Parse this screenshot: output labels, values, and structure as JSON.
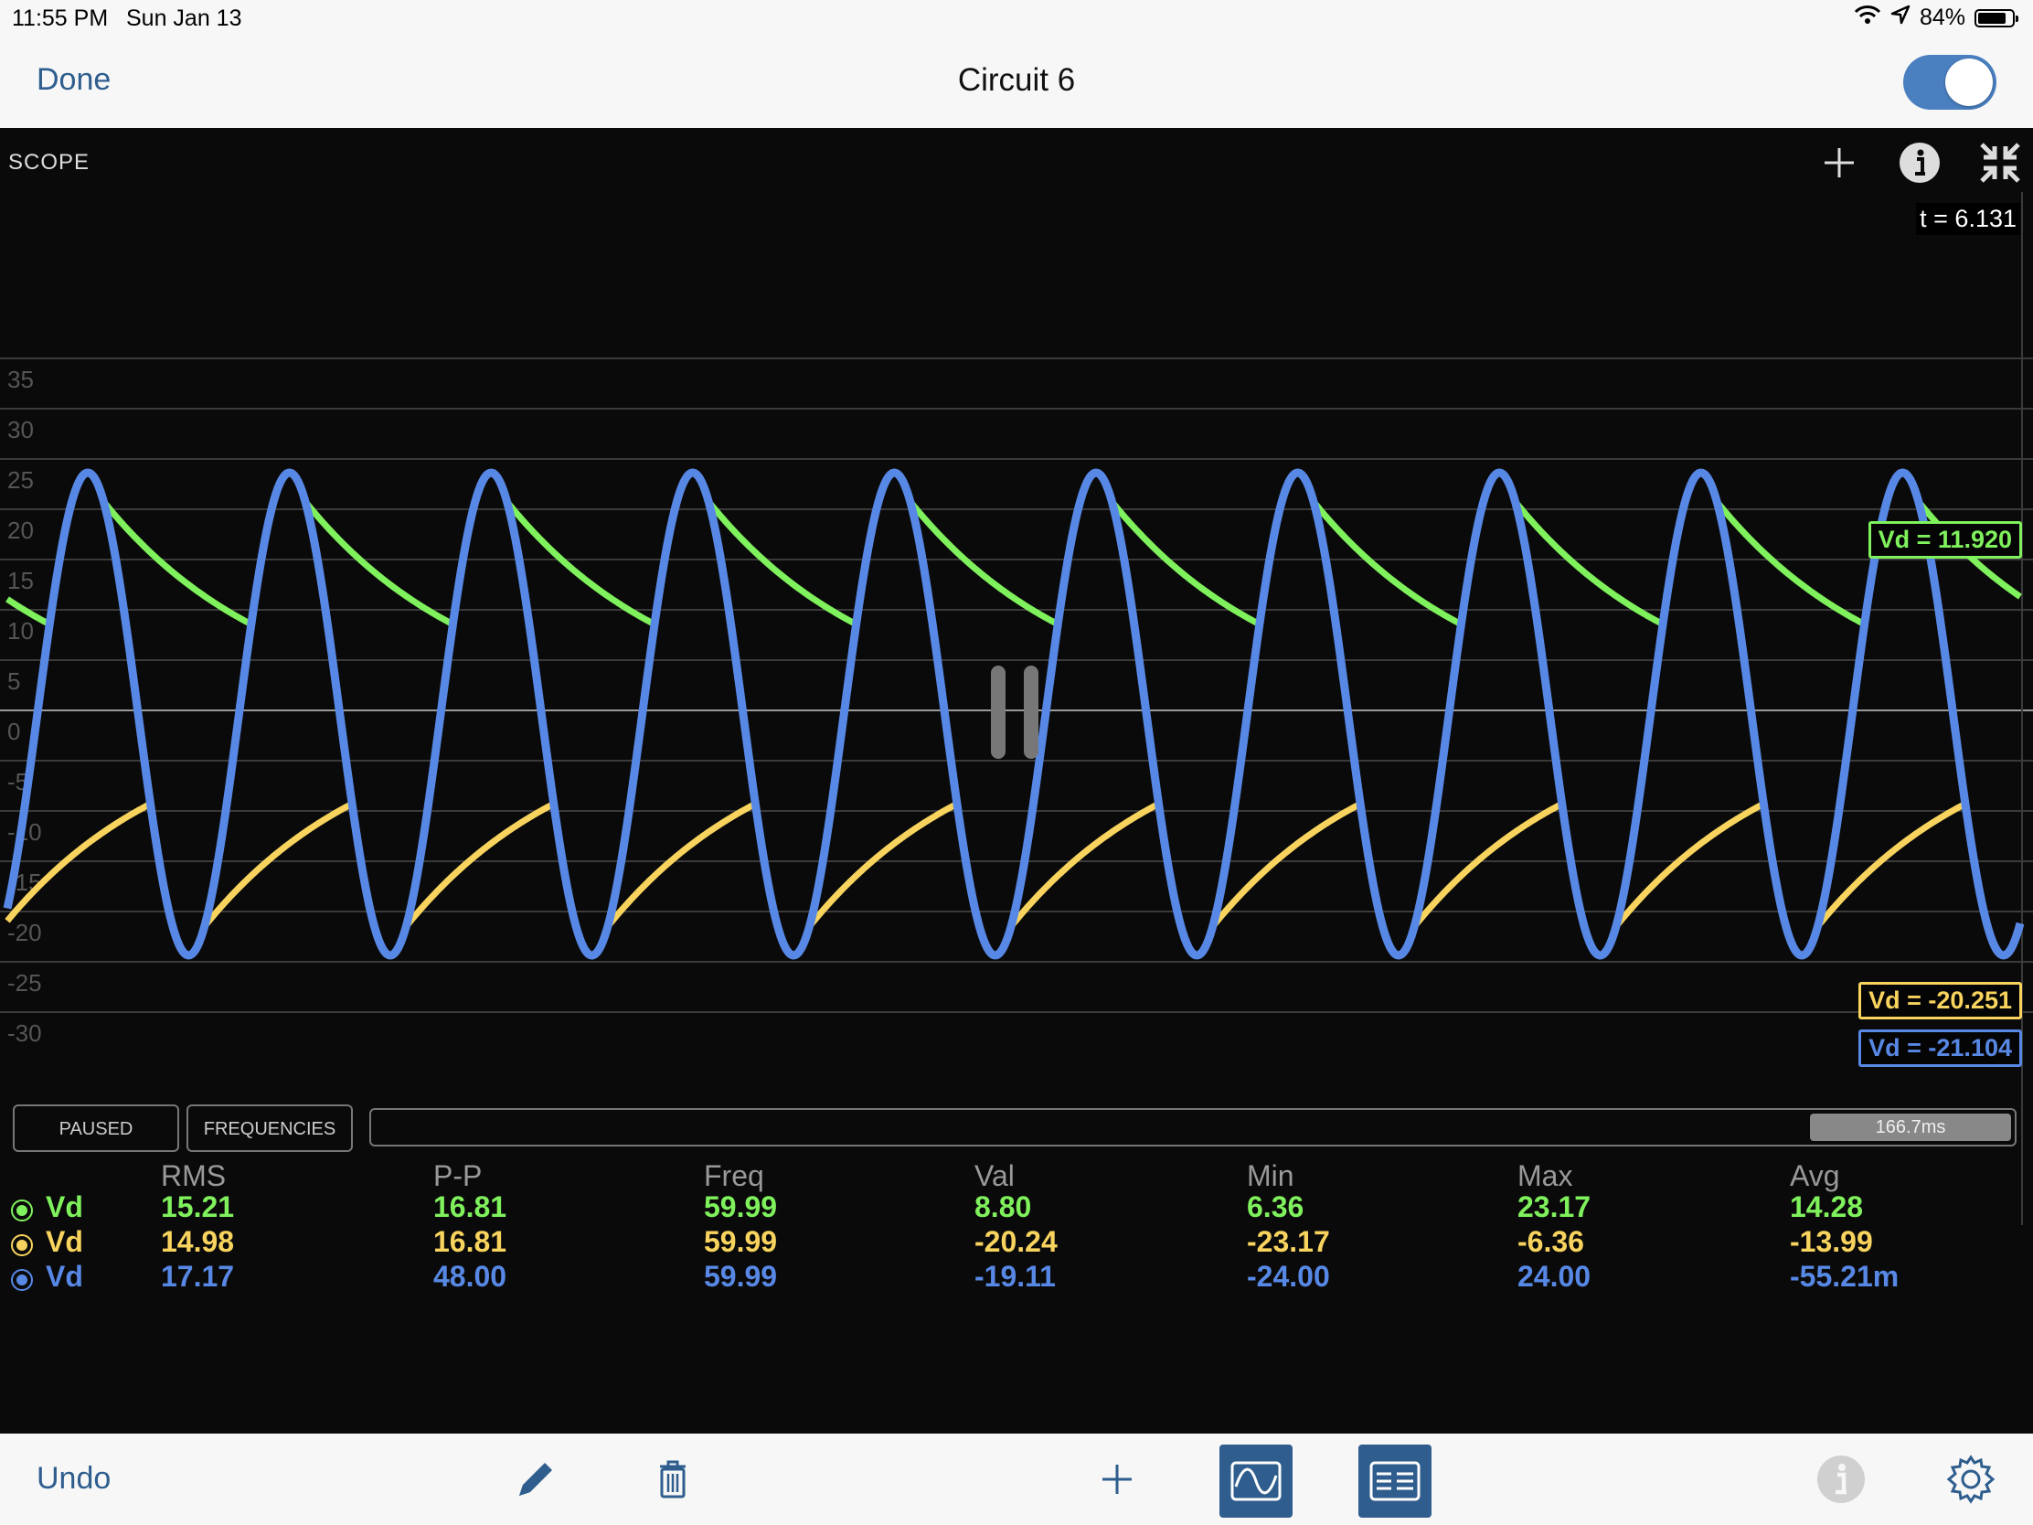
{
  "status_bar": {
    "time": "11:55 PM",
    "date": "Sun Jan 13",
    "battery": "84%",
    "battery_level": 0.84,
    "icons": [
      "wifi-icon",
      "location-icon",
      "battery-icon"
    ]
  },
  "nav": {
    "done_label": "Done",
    "title": "Circuit 6",
    "toggle_on": true
  },
  "scope": {
    "label": "SCOPE",
    "time_readout": "t = 6.131",
    "state": "paused",
    "markers": [
      {
        "text": "Vd = 11.920",
        "color": "#7ff15c"
      },
      {
        "text": "Vd = -20.251",
        "color": "#f8d45e"
      },
      {
        "text": "Vd = -21.104",
        "color": "#5888e5"
      }
    ],
    "icons": [
      "plus-icon",
      "info-icon",
      "collapse-icon"
    ]
  },
  "chart_data": {
    "type": "line",
    "ylim": [
      -35,
      35
    ],
    "y_ticks": [
      "35",
      "30",
      "25",
      "20",
      "15",
      "10",
      "5",
      "0",
      "-5",
      "-10",
      "-15",
      "-20",
      "-25",
      "-30"
    ],
    "frequency_hz": 59.99,
    "window_ms": 166.7,
    "series": [
      {
        "color": "#7ff15c",
        "kind": "rectifier-positive",
        "peak": 23.17,
        "min": 6.36
      },
      {
        "color": "#f8d45e",
        "kind": "rectifier-negative",
        "peak": -23.17,
        "max": -6.36
      },
      {
        "color": "#5888e5",
        "kind": "sine",
        "amplitude": 24.0,
        "min": -24.0
      }
    ]
  },
  "controls": {
    "paused_label": "PAUSED",
    "frequencies_label": "FREQUENCIES",
    "window_label": "166.7ms"
  },
  "stats": {
    "headers": [
      "RMS",
      "P-P",
      "Freq",
      "Val",
      "Min",
      "Max",
      "Avg"
    ],
    "rows": [
      {
        "name": "Vd",
        "color": "#7ff15c",
        "values": [
          "15.21",
          "16.81",
          "59.99",
          "8.80",
          "6.36",
          "23.17",
          "14.28"
        ]
      },
      {
        "name": "Vd",
        "color": "#f8d45e",
        "values": [
          "14.98",
          "16.81",
          "59.99",
          "-20.24",
          "-23.17",
          "-6.36",
          "-13.99"
        ]
      },
      {
        "name": "Vd",
        "color": "#5888e5",
        "values": [
          "17.17",
          "48.00",
          "59.99",
          "-19.11",
          "-24.00",
          "24.00",
          "-55.21m"
        ]
      }
    ]
  },
  "toolbar": {
    "undo_label": "Undo",
    "icons": [
      "pencil-icon",
      "trash-icon",
      "add-icon",
      "scope-icon",
      "table-icon",
      "info-icon",
      "settings-icon"
    ]
  }
}
